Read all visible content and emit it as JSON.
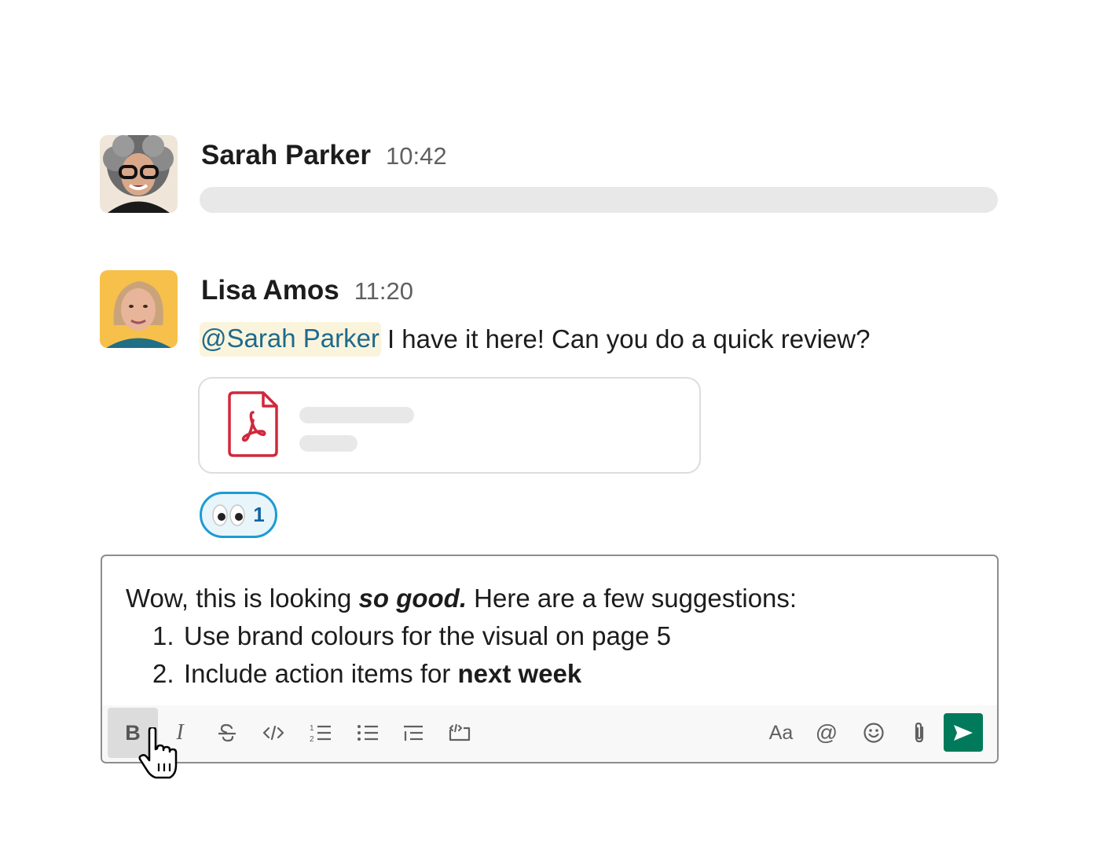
{
  "messages": [
    {
      "author": "Sarah Parker",
      "time": "10:42",
      "avatar_icon": "avatar-sarah-parker"
    },
    {
      "author": "Lisa Amos",
      "time": "11:20",
      "avatar_icon": "avatar-lisa-amos",
      "mention": "@Sarah Parker",
      "text": "I have it here! Can you do a quick review?",
      "attachment": {
        "type": "pdf",
        "icon": "pdf-file-icon"
      },
      "reactions": [
        {
          "emoji": "👀",
          "count": "1"
        }
      ]
    }
  ],
  "composer": {
    "intro_prefix": "Wow, this is looking ",
    "intro_emphasis": "so good.",
    "intro_suffix": " Here are a few suggestions:",
    "items": [
      {
        "number": "1.",
        "text": "Use brand colours for the visual on page 5",
        "bold": ""
      },
      {
        "number": "2.",
        "text": "Include action items for ",
        "bold": "next week"
      }
    ],
    "toolbar": {
      "bold_label": "B",
      "italic_label": "I",
      "format_label": "Aa",
      "mention_label": "@"
    }
  },
  "colors": {
    "mention_bg": "#fbf4dc",
    "mention_text": "#1d6a8c",
    "reaction_border": "#1d9bd1",
    "send_button": "#007a5a",
    "pdf_red": "#d0283c"
  }
}
